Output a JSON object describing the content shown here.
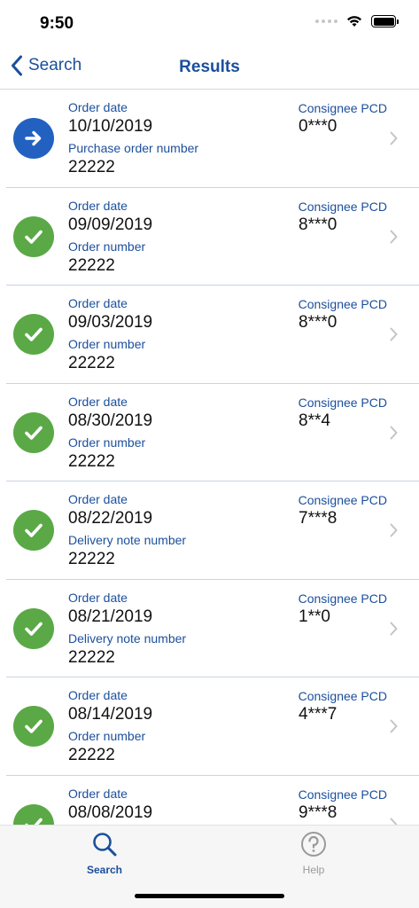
{
  "status_bar": {
    "time": "9:50"
  },
  "nav": {
    "back_label": "Search",
    "title": "Results"
  },
  "results": [
    {
      "status": "arrow",
      "date_label": "Order date",
      "date": "10/10/2019",
      "number_label": "Purchase order number",
      "number": "22222",
      "pcd_label": "Consignee PCD",
      "pcd": "0***0"
    },
    {
      "status": "check",
      "date_label": "Order date",
      "date": "09/09/2019",
      "number_label": "Order number",
      "number": "22222",
      "pcd_label": "Consignee PCD",
      "pcd": "8***0"
    },
    {
      "status": "check",
      "date_label": "Order date",
      "date": "09/03/2019",
      "number_label": "Order number",
      "number": "22222",
      "pcd_label": "Consignee PCD",
      "pcd": "8***0"
    },
    {
      "status": "check",
      "date_label": "Order date",
      "date": "08/30/2019",
      "number_label": "Order number",
      "number": "22222",
      "pcd_label": "Consignee PCD",
      "pcd": "8**4"
    },
    {
      "status": "check",
      "date_label": "Order date",
      "date": "08/22/2019",
      "number_label": "Delivery note number",
      "number": "22222",
      "pcd_label": "Consignee PCD",
      "pcd": "7***8"
    },
    {
      "status": "check",
      "date_label": "Order date",
      "date": "08/21/2019",
      "number_label": "Delivery note number",
      "number": "22222",
      "pcd_label": "Consignee PCD",
      "pcd": "1**0"
    },
    {
      "status": "check",
      "date_label": "Order date",
      "date": "08/14/2019",
      "number_label": "Order number",
      "number": "22222",
      "pcd_label": "Consignee PCD",
      "pcd": "4***7"
    },
    {
      "status": "check",
      "date_label": "Order date",
      "date": "08/08/2019",
      "number_label": "",
      "number": "",
      "pcd_label": "Consignee PCD",
      "pcd": "9***8"
    }
  ],
  "tabs": {
    "search_label": "Search",
    "help_label": "Help"
  },
  "colors": {
    "accent": "#1b4f9c",
    "success": "#5aa946",
    "active": "#2361c1"
  }
}
